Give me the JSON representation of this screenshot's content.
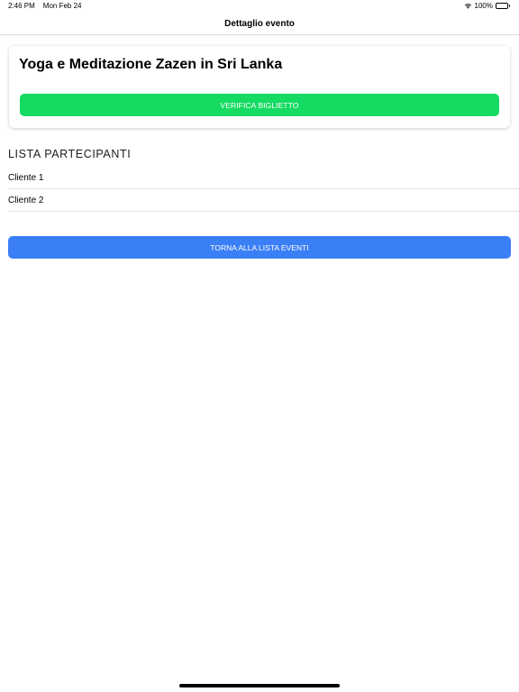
{
  "status_bar": {
    "time": "2:46 PM",
    "date": "Mon Feb 24",
    "battery_percent": "100%",
    "battery_level": 1.0,
    "icons": [
      "wifi-icon",
      "battery-icon"
    ]
  },
  "nav": {
    "title": "Dettaglio evento"
  },
  "event": {
    "title": "Yoga e Meditazione Zazen in Sri Lanka",
    "verify_label": "VERIFICA BIGLIETTO"
  },
  "participants": {
    "heading": "LISTA PARTECIPANTI",
    "items": [
      {
        "label": "Cliente 1"
      },
      {
        "label": "Cliente 2"
      }
    ]
  },
  "actions": {
    "back_label": "TORNA ALLA LISTA EVENTI"
  },
  "colors": {
    "verify_button": "#16db62",
    "back_button": "#3b7ff6",
    "separator": "#e2e2e2"
  }
}
